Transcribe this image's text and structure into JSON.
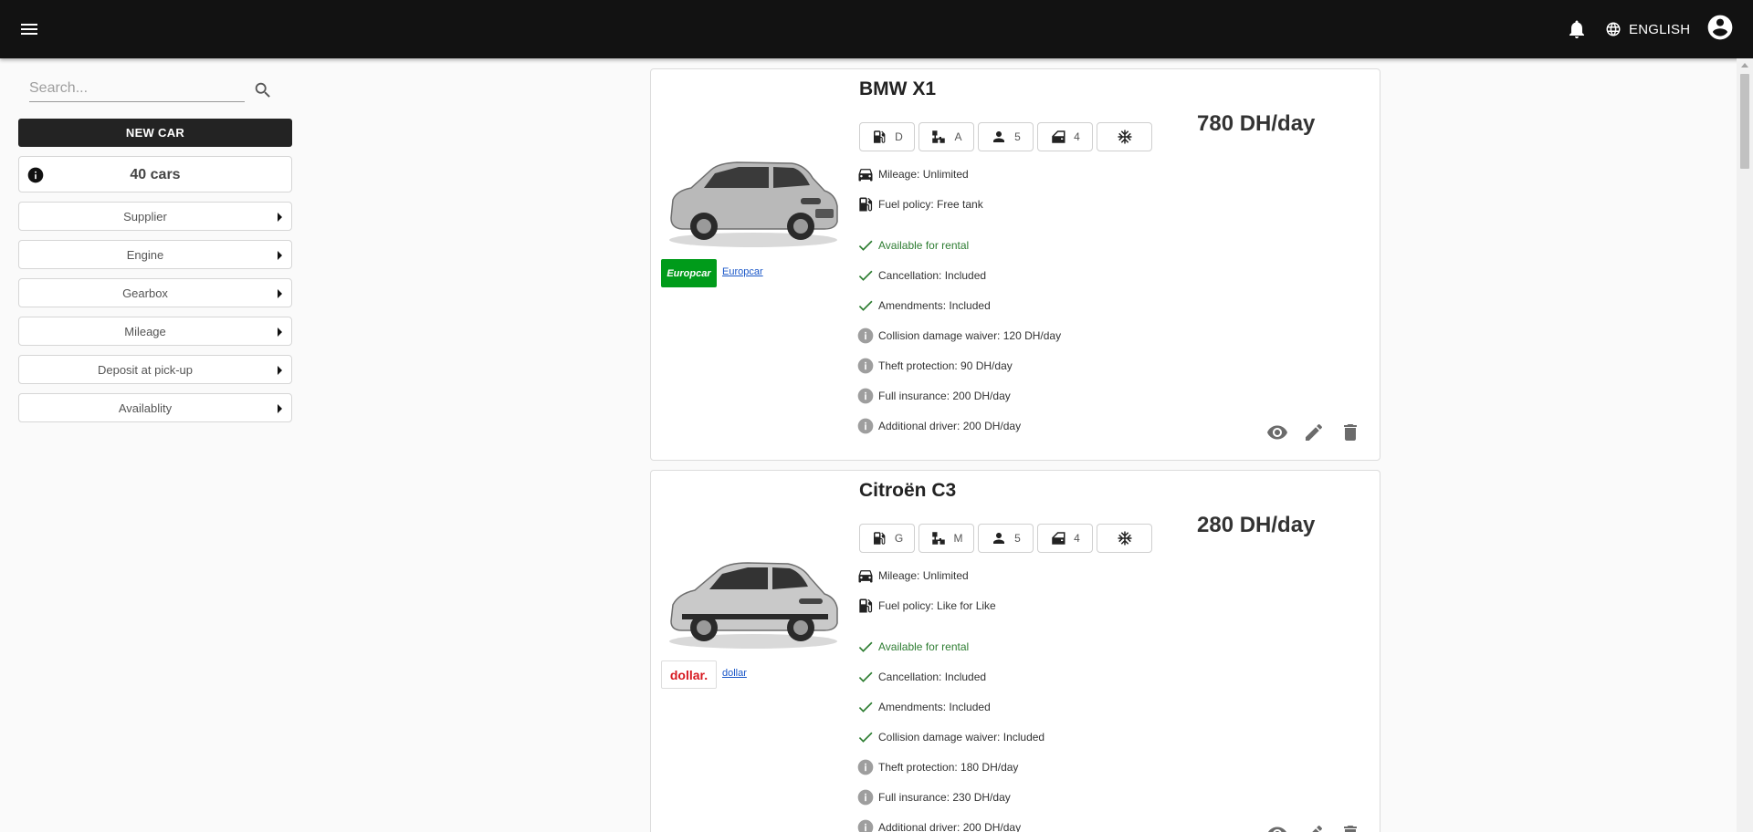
{
  "header": {
    "language": "ENGLISH",
    "menu_icon": "menu-icon",
    "notifications_icon": "bell-icon",
    "language_icon": "globe-icon",
    "account_icon": "account-circle-icon"
  },
  "sidebar": {
    "search_placeholder": "Search...",
    "new_car_label": "NEW CAR",
    "car_count": "40 cars",
    "filters": [
      "Supplier",
      "Engine",
      "Gearbox",
      "Mileage",
      "Deposit at pick-up",
      "Availablity"
    ]
  },
  "cars": [
    {
      "name": "BMW X1",
      "price": "780 DH/day",
      "supplier": {
        "name": "Europcar",
        "logo_text": "Europcar",
        "logo_bg": "#009b1a",
        "logo_color": "#ffffff"
      },
      "specs": {
        "engine": "D",
        "gearbox": "A",
        "seats": "5",
        "doors": "4"
      },
      "mileage": "Mileage: Unlimited",
      "fuel_policy": "Fuel policy: Free tank",
      "availability": "Available for rental",
      "extras": [
        {
          "text": "Cancellation: Included",
          "included": true
        },
        {
          "text": "Amendments: Included",
          "included": true
        },
        {
          "text": "Collision damage waiver: 120 DH/day",
          "included": false
        },
        {
          "text": "Theft protection: 90 DH/day",
          "included": false
        },
        {
          "text": "Full insurance: 200 DH/day",
          "included": false
        },
        {
          "text": "Additional driver: 200 DH/day",
          "included": false
        }
      ]
    },
    {
      "name": "Citroën C3",
      "price": "280 DH/day",
      "supplier": {
        "name": "dollar",
        "logo_text": "dollar.",
        "logo_bg": "#ffffff",
        "logo_color": "#d71920"
      },
      "specs": {
        "engine": "G",
        "gearbox": "M",
        "seats": "5",
        "doors": "4"
      },
      "mileage": "Mileage: Unlimited",
      "fuel_policy": "Fuel policy: Like for Like",
      "availability": "Available for rental",
      "extras": [
        {
          "text": "Cancellation: Included",
          "included": true
        },
        {
          "text": "Amendments: Included",
          "included": true
        },
        {
          "text": "Collision damage waiver: Included",
          "included": true
        },
        {
          "text": "Theft protection: 180 DH/day",
          "included": false
        },
        {
          "text": "Full insurance: 230 DH/day",
          "included": false
        },
        {
          "text": "Additional driver: 200 DH/day",
          "included": false
        }
      ]
    }
  ]
}
